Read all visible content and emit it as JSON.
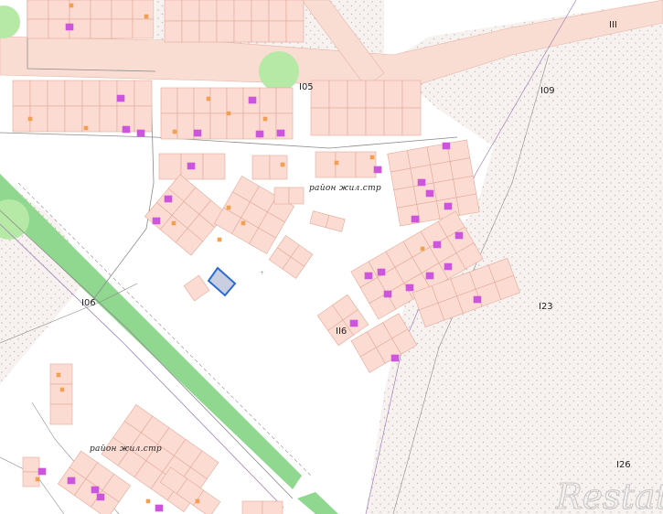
{
  "map": {
    "colors": {
      "background": "#ffffff",
      "dotted_zone": "#f7f2f0",
      "dots": "#bfb5b0",
      "parcel_fill": "#fcdcd2",
      "parcel_stroke": "#e2a999",
      "road_band": "#f9ddd3",
      "green_strip": "#90d890",
      "green_patch": "#b6e8a6",
      "building_magenta": "#cc55dd",
      "building_orange": "#f0a050",
      "selected_fill": "#c9cfe0",
      "selected_stroke": "#2a6bd6",
      "line_gray": "#8a8a8a",
      "line_purple": "#a080b8"
    },
    "block_labels": [
      {
        "id": "105",
        "text": "I05"
      },
      {
        "id": "106",
        "text": "I06"
      },
      {
        "id": "109",
        "text": "I09"
      },
      {
        "id": "111",
        "text": "III"
      },
      {
        "id": "116",
        "text": "II6"
      },
      {
        "id": "123",
        "text": "I23"
      },
      {
        "id": "126",
        "text": "I26"
      }
    ],
    "district_labels": [
      {
        "id": "north",
        "text": "район жил.стр"
      },
      {
        "id": "south",
        "text": "район жил.стр"
      }
    ],
    "selected_parcel": {
      "name": "selected-parcel"
    },
    "watermark": {
      "text": "Restate"
    }
  }
}
